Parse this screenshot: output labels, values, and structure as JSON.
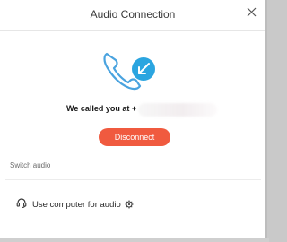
{
  "window": {
    "title": "Audio Connection",
    "close_icon": "close-icon"
  },
  "call_status": {
    "graphic_icon": "phone-incoming-call-icon",
    "message": "We called you at +",
    "phone_number_redacted": true
  },
  "actions": {
    "disconnect_label": "Disconnect",
    "disconnect_color": "#f05a3f"
  },
  "switch_audio": {
    "section_label": "Switch audio",
    "options": [
      {
        "label": "Use computer for audio",
        "icon": "headset-icon",
        "settings_icon": "gear-icon"
      }
    ]
  },
  "colors": {
    "accent_blue": "#2ba5e0",
    "phone_outline": "#4aa3df"
  }
}
